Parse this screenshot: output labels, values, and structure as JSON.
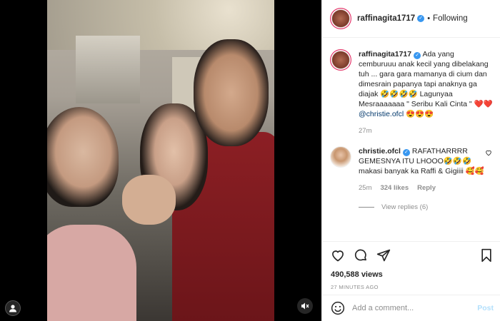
{
  "post": {
    "username": "raffinagita1717",
    "follow_status": "Following",
    "dot": "•"
  },
  "caption": {
    "username": "raffinagita1717",
    "text": "Ada yang cemburuuu anak kecil yang dibelakang tuh ... gara gara mamanya di cium dan dimesrain papanya tapi anaknya ga diajak 🤣🤣🤣🤣 Lagunyaa Mesraaaaaaa \" Seribu Kali Cinta \" ❤️❤️",
    "mention": "@christie.ofcl",
    "mention_emojis": "😍😍😍",
    "time": "27m"
  },
  "comment": {
    "username": "christie.ofcl",
    "text": "RAFATHARRRR GEMESNYA ITU LHOOO🤣🤣🤣 makasi banyak ka Raffi & Gigiiii 🥰🥰",
    "time": "25m",
    "likes": "324 likes",
    "reply": "Reply",
    "view_replies": "View replies (6)"
  },
  "stats": {
    "views": "490,588 views",
    "time_ago": "27 MINUTES AGO"
  },
  "add_comment": {
    "placeholder": "Add a comment...",
    "post_label": "Post"
  },
  "colors": {
    "verified": "#3897f0",
    "post_disabled": "#b2dffc",
    "meta_gray": "#8e8e8e"
  }
}
